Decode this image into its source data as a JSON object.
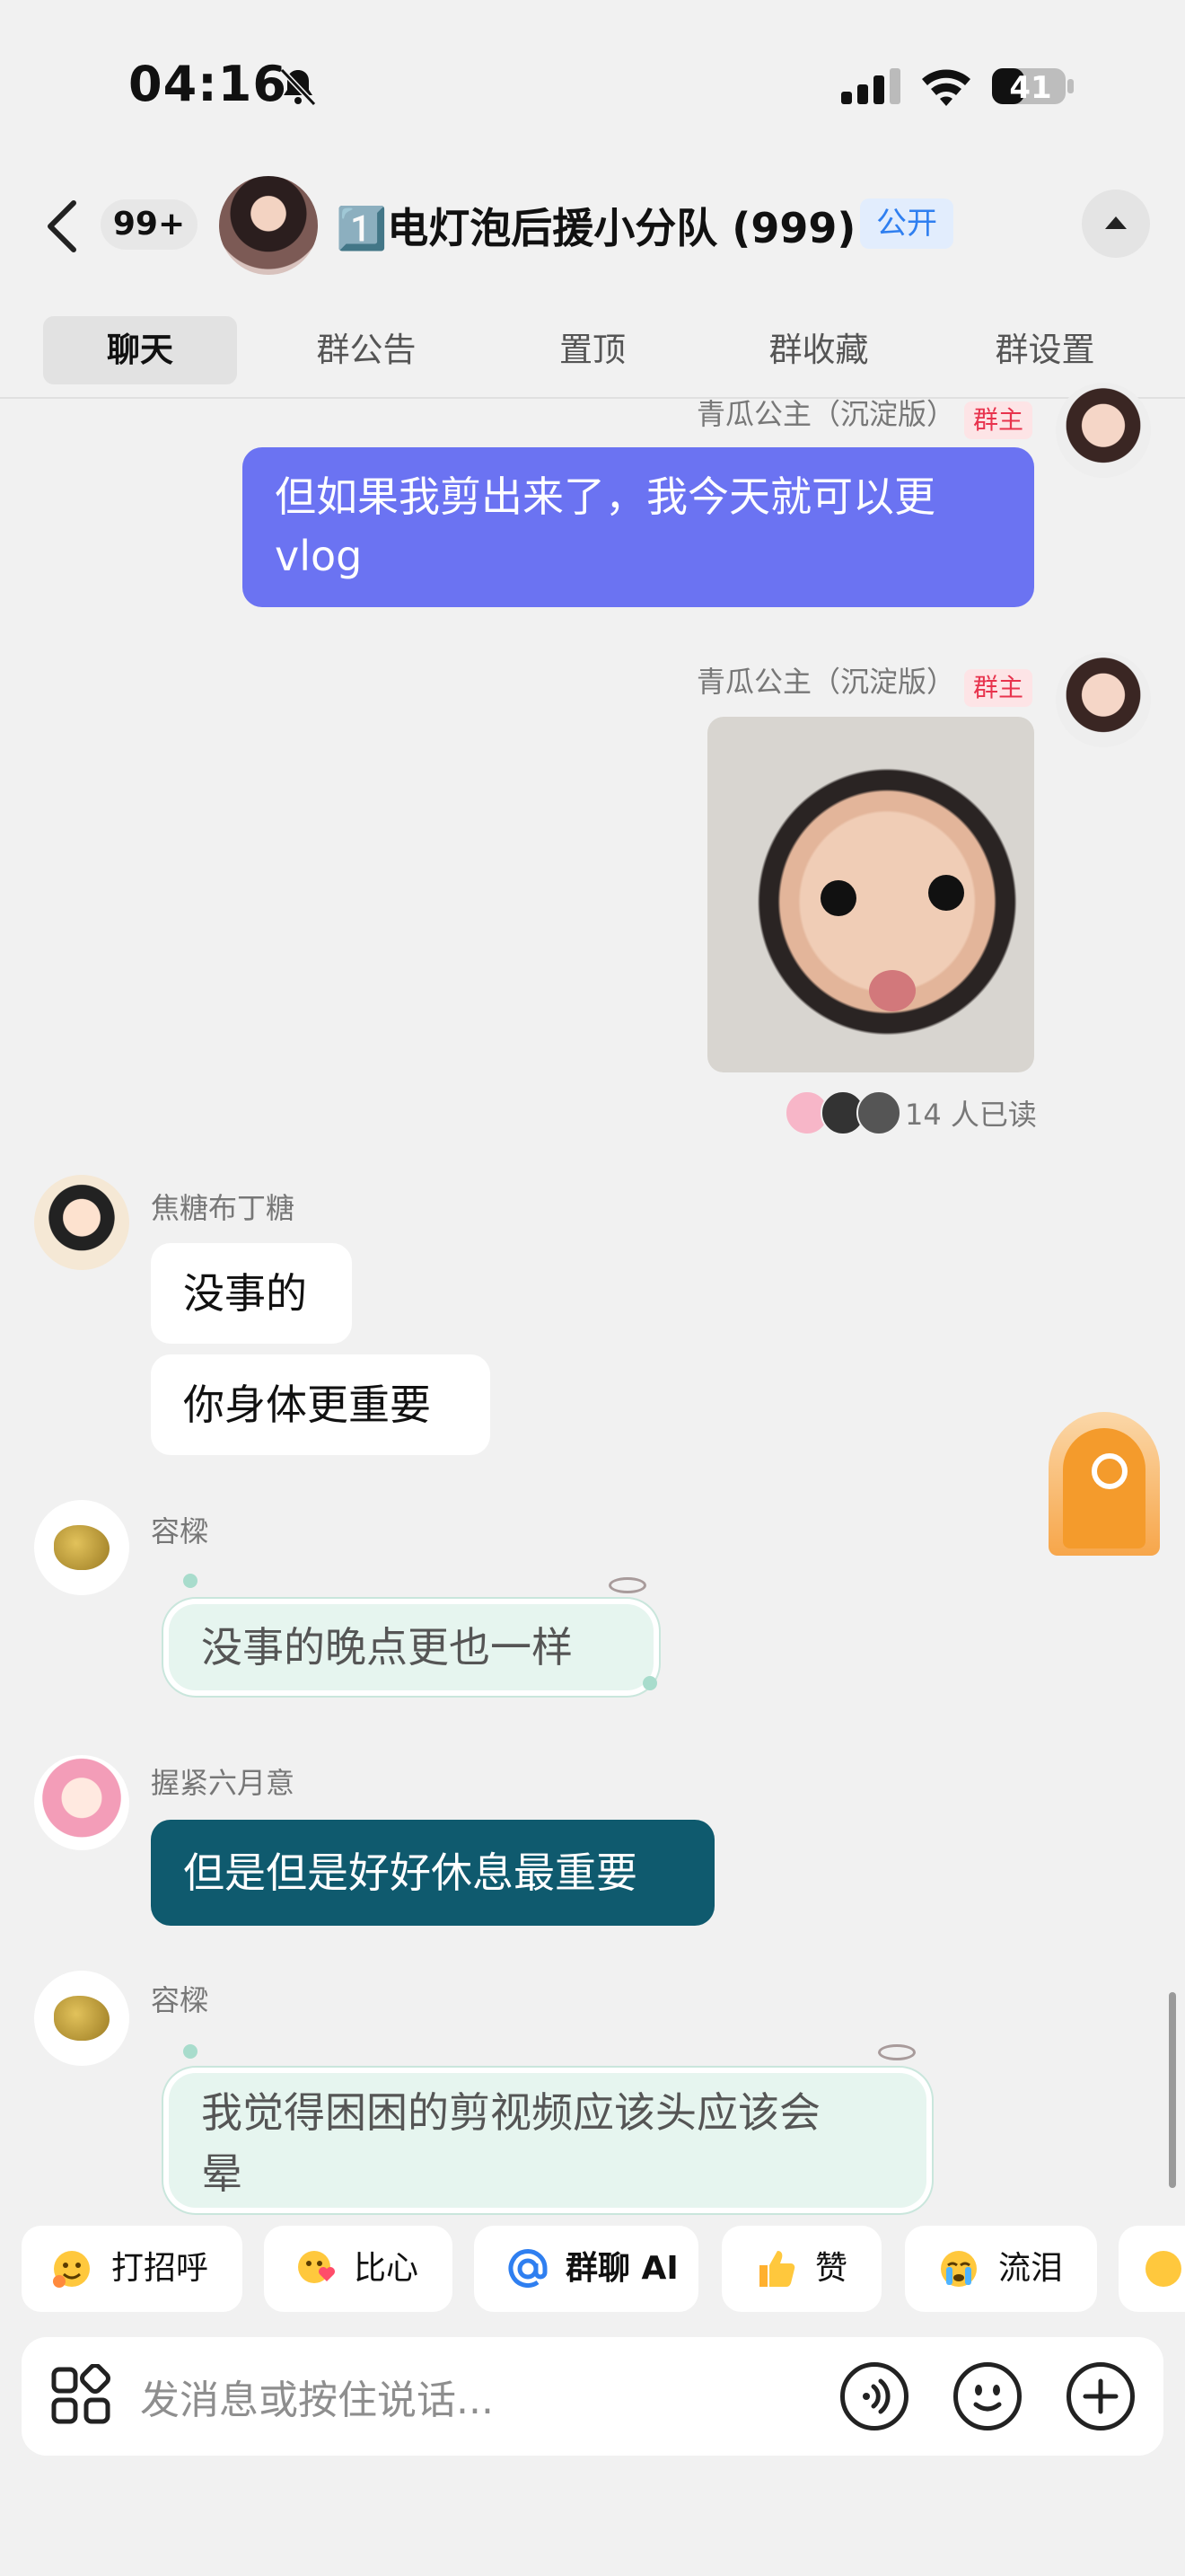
{
  "status_bar": {
    "time": "04:16",
    "battery": "41"
  },
  "header": {
    "unread_count": "99+",
    "group_name": "1️⃣电灯泡后援小分队 (999)",
    "public_badge": "公开"
  },
  "tabs": [
    "聊天",
    "群公告",
    "置顶",
    "群收藏",
    "群设置"
  ],
  "messages": {
    "m1": {
      "sender": "青瓜公主（沉淀版）",
      "role": "群主",
      "text_line1": "但如果我剪出来了，我今天就可以更",
      "text_line2": "vlog"
    },
    "m2": {
      "sender": "青瓜公主（沉淀版）",
      "role": "群主",
      "read_receipt": "14 人已读"
    },
    "m3": {
      "sender": "焦糖布丁糖",
      "text_a": "没事的",
      "text_b": "你身体更重要"
    },
    "m4": {
      "sender": "容樑",
      "text": "没事的晚点更也一样"
    },
    "m5": {
      "sender": "握紧六月意",
      "text": "但是但是好好休息最重要"
    },
    "m6": {
      "sender": "容樑",
      "text_line1": "我觉得困困的剪视频应该头应该会",
      "text_line2": "晕"
    }
  },
  "quick_replies": [
    {
      "label": "打招呼",
      "icon": "wave-emoji-icon"
    },
    {
      "label": "比心",
      "icon": "heart-hands-emoji-icon"
    },
    {
      "label": "群聊 AI",
      "icon": "at-icon"
    },
    {
      "label": "赞",
      "icon": "thumbs-up-icon"
    },
    {
      "label": "流泪",
      "icon": "crying-emoji-icon"
    }
  ],
  "input": {
    "placeholder": "发消息或按住说话..."
  },
  "colors": {
    "accent_blue": "#6b73f2",
    "teal_bubble": "#0f5a6e",
    "owner_badge": "#e8334d",
    "public_badge": "#2f7ff0"
  }
}
